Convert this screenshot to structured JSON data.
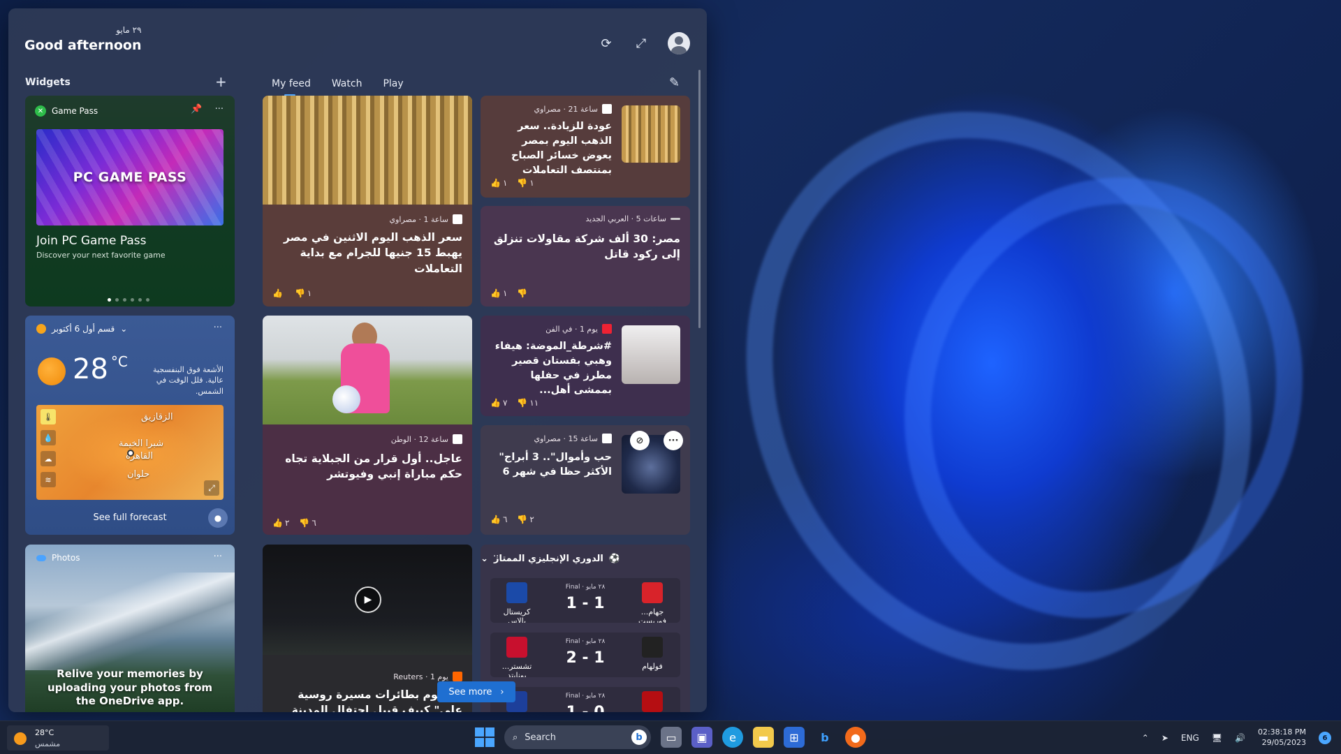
{
  "header": {
    "date": "٢٩ مايو",
    "greeting": "Good afternoon"
  },
  "widgets": {
    "title": "Widgets",
    "gamepass": {
      "name": "Game Pass",
      "banner": "PC GAME PASS",
      "title": "Join PC Game Pass",
      "subtitle": "Discover your next favorite game"
    },
    "weather": {
      "location": "قسم أول 6 أكتوبر",
      "temp": "28",
      "unit": "°C",
      "description": "الأشعة فوق البنفسجية عالية. قلل الوقت في الشمس.",
      "city_1": "الزقازيق",
      "city_2": "شبرا الخيمة",
      "city_3": "القاهرة",
      "city_4": "حلوان",
      "forecast_link": "See full forecast"
    },
    "photos": {
      "name": "Photos",
      "text": "Relive your memories by uploading your photos from the OneDrive app."
    }
  },
  "tabs": [
    "My feed",
    "Watch",
    "Play"
  ],
  "news": [
    {
      "meta": "ساعة 1 · مصراوي",
      "headline": "سعر الذهب اليوم الاثنين في مصر يهبط 15 جنيها للجرام مع بداية التعاملات",
      "likes": "",
      "dislikes": "١"
    },
    {
      "meta": "ساعة 21 · مصراوي",
      "headline": "عودة للزيادة.. سعر الذهب اليوم بمصر يعوض خسائر الصباح بمنتصف التعاملات",
      "likes": "١",
      "dislikes": "١"
    },
    {
      "meta": "ساعات 5 · العربي الجديد",
      "headline": "مصر: 30 ألف شركة مقاولات تنزلق إلى ركود قاتل",
      "likes": "١",
      "dislikes": ""
    },
    {
      "meta": "ساعة 12 · الوطن",
      "headline": "عاجل.. أول قرار من الجبلاية تجاه حكم مباراة إنبي وفيوتشر",
      "likes": "٢",
      "dislikes": "٦"
    },
    {
      "meta": "يوم 1 · في الفن",
      "headline": "#شرطة_الموضة: هيفاء وهبي بفستان قصير مطرز في حفلها بممشى أهل...",
      "likes": "٧",
      "dislikes": "١١"
    },
    {
      "meta": "ساعة 15 · مصراوي",
      "headline": "حب وأموال\".. 3 أبراج\" الأكثر حظا في شهر 6",
      "likes": "٦",
      "dislikes": "٢"
    },
    {
      "meta": "Reuters · يوم 1",
      "headline": "\" هجوم بطائرات مسيرة روسية على\" كييف قبيل احتفال المدينة بذكرى تأسيسها",
      "likes": "",
      "dislikes": ""
    }
  ],
  "see_more": "See more",
  "league": {
    "name": "الدوري الإنجليزي الممتاز",
    "matches": [
      {
        "meta": "Final · ٢٨ مايو",
        "score": "1 - 1",
        "left": "كريستال بالاس",
        "right": "...جهام فوريست",
        "left_color": "#1b4aa8",
        "right_color": "#d8232a"
      },
      {
        "meta": "Final · ٢٨ مايو",
        "score": "2 - 1",
        "left": "...تشستر يونايتد",
        "right": "فولهام",
        "left_color": "#c8102e",
        "right_color": "#222222"
      },
      {
        "meta": "Final · ٢٨ مايو",
        "score": "1 - 0",
        "left": "",
        "right": "",
        "left_color": "#1d3f9a",
        "right_color": "#b50e12"
      }
    ]
  },
  "taskbar": {
    "temp": "28°C",
    "condition": "مشمس",
    "search": "Search",
    "lang": "ENG",
    "time": "02:38:18 PM",
    "date": "29/05/2023",
    "notifications": "6"
  }
}
